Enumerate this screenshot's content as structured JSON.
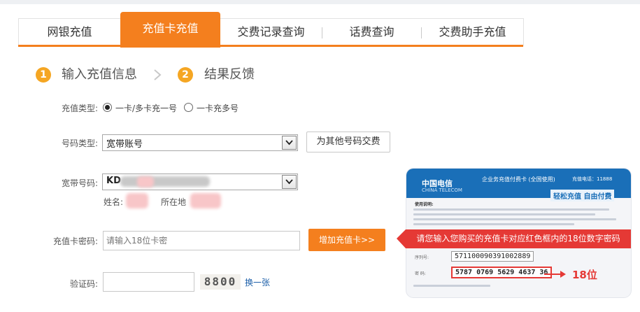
{
  "tabs": [
    "网银充值",
    "充值卡充值",
    "交费记录查询",
    "话费查询",
    "交费助手充值"
  ],
  "steps": [
    {
      "num": "1",
      "label": "输入充值信息"
    },
    {
      "num": "2",
      "label": "结果反馈"
    }
  ],
  "form": {
    "recharge_type_label": "充值类型:",
    "recharge_type_options": [
      "一卡/多卡充一号",
      "一卡充多号"
    ],
    "number_type_label": "号码类型:",
    "number_type_value": "宽带账号",
    "pay_other_button": "为其他号码交费",
    "broadband_label": "宽带号码:",
    "broadband_value": "KD",
    "name_label": "姓名:",
    "location_label": "所在地",
    "card_password_label": "充值卡密码:",
    "card_password_placeholder": "请输入18位卡密",
    "add_card_button": "增加充值卡>>",
    "captcha_label": "验证码:",
    "captcha_value": "8800",
    "captcha_refresh": "换一张"
  },
  "card": {
    "brand": "中国电信",
    "brand_en": "CHINA TELECOM",
    "card_title": "企业务充值付费卡",
    "card_scope": "全国使用",
    "card_phone": "充值电话：11888",
    "slogan": "轻松充值 自由付费",
    "usage_title": "使用说明:",
    "serial_label": "序列号:",
    "serial_value": "571100090391002889",
    "password_label": "密  码:",
    "password_value": "5787 0769 5629 4637 36"
  },
  "callout": "请您输入您购买的充值卡对应红色框内的18位数字密码",
  "digit_hint": "18位",
  "colors": {
    "accent": "#f47f1e",
    "alert": "#e53935",
    "step": "#f5a623",
    "telecom_blue": "#1a6fb8"
  }
}
